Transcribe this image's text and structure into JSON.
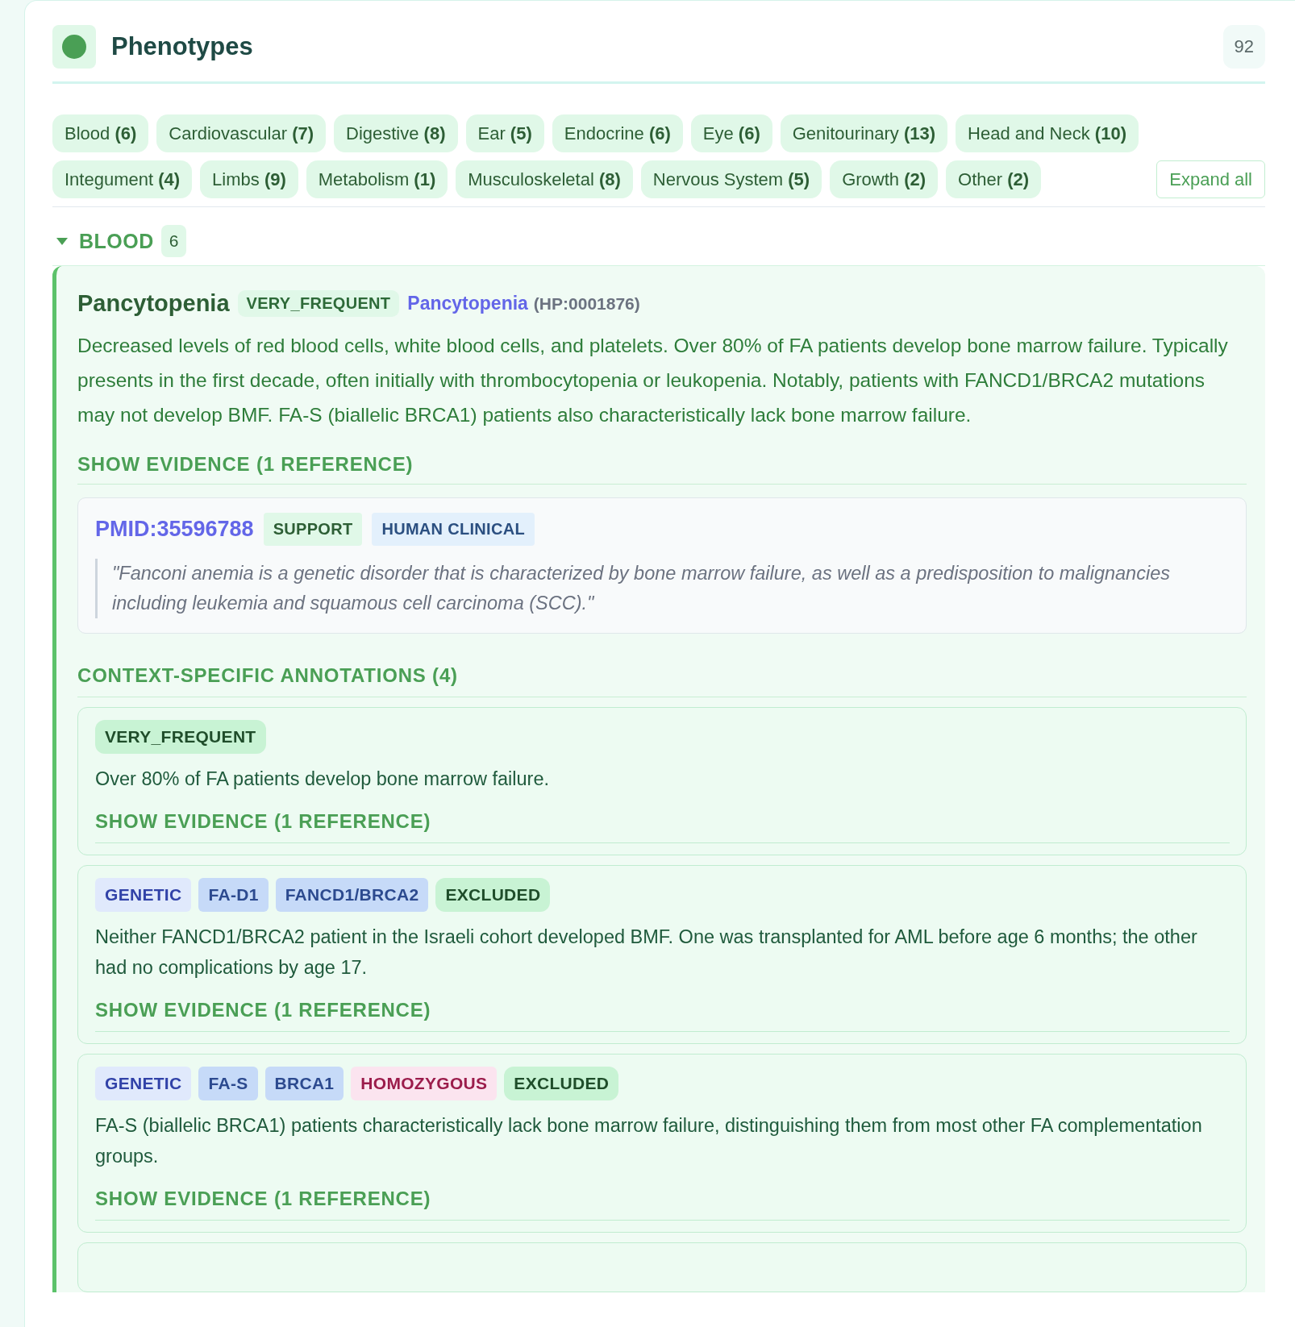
{
  "header": {
    "title": "Phenotypes",
    "count": "92"
  },
  "categories": [
    {
      "label": "Blood",
      "count": "(6)"
    },
    {
      "label": "Cardiovascular",
      "count": "(7)"
    },
    {
      "label": "Digestive",
      "count": "(8)"
    },
    {
      "label": "Ear",
      "count": "(5)"
    },
    {
      "label": "Endocrine",
      "count": "(6)"
    },
    {
      "label": "Eye",
      "count": "(6)"
    },
    {
      "label": "Genitourinary",
      "count": "(13)"
    },
    {
      "label": "Head and Neck",
      "count": "(10)"
    },
    {
      "label": "Integument",
      "count": "(4)"
    },
    {
      "label": "Limbs",
      "count": "(9)"
    },
    {
      "label": "Metabolism",
      "count": "(1)"
    },
    {
      "label": "Musculoskeletal",
      "count": "(8)"
    },
    {
      "label": "Nervous System",
      "count": "(5)"
    },
    {
      "label": "Growth",
      "count": "(2)"
    },
    {
      "label": "Other",
      "count": "(2)"
    }
  ],
  "expand_all": "Expand all",
  "section": {
    "title": "BLOOD",
    "count": "6",
    "expanded": true
  },
  "phenotype": {
    "name": "Pancytopenia",
    "frequency": "VERY_FREQUENT",
    "term": "Pancytopenia",
    "term_id": "(HP:0001876)",
    "description": "Decreased levels of red blood cells, white blood cells, and platelets. Over 80% of FA patients develop bone marrow failure. Typically presents in the first decade, often initially with thrombocytopenia or leukopenia. Notably, patients with FANCD1/BRCA2 mutations may not develop BMF. FA-S (biallelic BRCA1) patients also characteristically lack bone marrow failure.",
    "evidence_toggle": "SHOW EVIDENCE (1 REFERENCE)",
    "references": [
      {
        "pmid": "PMID:35596788",
        "tags": [
          {
            "text": "SUPPORT",
            "kind": "support"
          },
          {
            "text": "HUMAN CLINICAL",
            "kind": "source"
          }
        ],
        "quote": "\"Fanconi anemia is a genetic disorder that is characterized by bone marrow failure, as well as a predisposition to malignancies including leukemia and squamous cell carcinoma (SCC).\""
      }
    ],
    "annotations_title": "CONTEXT-SPECIFIC ANNOTATIONS (4)",
    "annotations": [
      {
        "tags": [
          {
            "text": "VERY_FREQUENT",
            "kind": "frequency"
          }
        ],
        "text": "Over 80% of FA patients develop bone marrow failure.",
        "evidence_toggle": "SHOW EVIDENCE (1 REFERENCE)"
      },
      {
        "tags": [
          {
            "text": "GENETIC",
            "kind": "context"
          },
          {
            "text": "FA-D1",
            "kind": "subtype"
          },
          {
            "text": "FANCD1/BRCA2",
            "kind": "subtype"
          },
          {
            "text": "EXCLUDED",
            "kind": "frequency"
          }
        ],
        "text": "Neither FANCD1/BRCA2 patient in the Israeli cohort developed BMF. One was transplanted for AML before age 6 months; the other had no complications by age 17.",
        "evidence_toggle": "SHOW EVIDENCE (1 REFERENCE)"
      },
      {
        "tags": [
          {
            "text": "GENETIC",
            "kind": "context"
          },
          {
            "text": "FA-S",
            "kind": "subtype"
          },
          {
            "text": "BRCA1",
            "kind": "subtype"
          },
          {
            "text": "HOMOZYGOUS",
            "kind": "zygosity"
          },
          {
            "text": "EXCLUDED",
            "kind": "frequency"
          }
        ],
        "text": "FA-S (biallelic BRCA1) patients characteristically lack bone marrow failure, distinguishing them from most other FA complementation groups.",
        "evidence_toggle": "SHOW EVIDENCE (1 REFERENCE)"
      }
    ]
  }
}
